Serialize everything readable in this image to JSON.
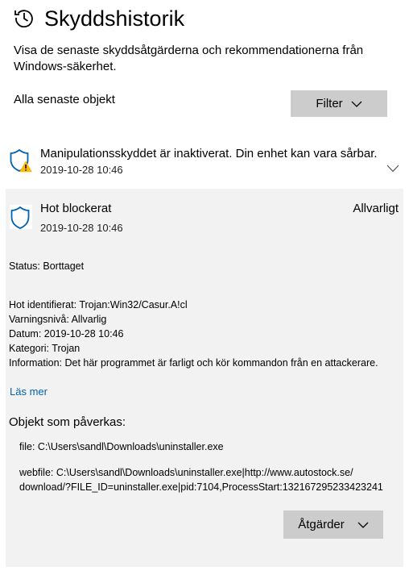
{
  "header": {
    "title": "Skyddshistorik",
    "description": "Visa de senaste skyddsåtgärderna och rekommendationerna från Windows-säkerhet."
  },
  "filter_bar": {
    "scope_label": "Alla senaste objekt",
    "filter_button": "Filter"
  },
  "items": [
    {
      "icon": "shield-warning-icon",
      "title": "Manipulationsskyddet är inaktiverat. Din enhet kan vara sårbar.",
      "date": "2019-10-28 10:46",
      "expanded": false
    },
    {
      "icon": "shield-icon",
      "title": "Hot blockerat",
      "date": "2019-10-28 10:46",
      "severity": "Allvarligt",
      "expanded": true,
      "status": "Status:  Borttaget",
      "details": [
        "Hot identifierat:  Trojan:Win32/Casur.A!cl",
        "Varningsnivå:  Allvarlig",
        "Datum:  2019-10-28 10:46",
        "Kategori:  Trojan",
        "Information:  Det här programmet är farligt och kör kommandon från en attackerare."
      ],
      "read_more": "Läs mer",
      "affected_heading": "Objekt som påverkas:",
      "affected": [
        "file:  C:\\Users\\sandl\\Downloads\\uninstaller.exe",
        "webfile:  C:\\Users\\sandl\\Downloads\\uninstaller.exe|http://www.autostock.se/",
        "download/?FILE_ID=uninstaller.exe|pid:7104,ProcessStart:132167295233423241"
      ],
      "actions_button": "Åtgärder"
    }
  ],
  "colors": {
    "accent": "#0063b1",
    "button_bg": "#cccccc",
    "panel_bg": "#f2f2f2",
    "warning": "#ffb900"
  }
}
